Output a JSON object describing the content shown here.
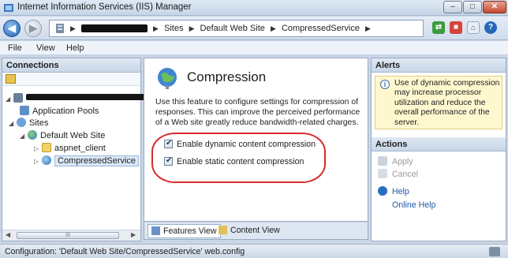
{
  "window": {
    "title": "Internet Information Services (IIS) Manager",
    "controls": {
      "minimize": "–",
      "maximize": "□",
      "close": "✕"
    }
  },
  "address_bar": {
    "breadcrumbs": [
      "Sites",
      "Default Web Site",
      "CompressedService"
    ],
    "separator": "▶"
  },
  "menu": {
    "file": "File",
    "view": "View",
    "help": "Help"
  },
  "connections": {
    "header": "Connections",
    "tree": {
      "app_pools": "Application Pools",
      "sites": "Sites",
      "default_web_site": "Default Web Site",
      "aspnet_client": "aspnet_client",
      "compressed_service": "CompressedService"
    },
    "scrollbar_grip": "III"
  },
  "feature": {
    "title": "Compression",
    "description": "Use this feature to configure settings for compression of responses. This can improve the perceived performance of a Web site greatly reduce bandwidth-related charges.",
    "checkboxes": [
      {
        "label": "Enable dynamic content compression",
        "checked": true
      },
      {
        "label": "Enable static content compression",
        "checked": true
      }
    ]
  },
  "view_tabs": {
    "features_view": "Features View",
    "content_view": "Content View"
  },
  "alerts": {
    "header": "Alerts",
    "message": "Use of dynamic compression may increase processor utilization and reduce the overall performance of the server."
  },
  "actions": {
    "header": "Actions",
    "apply": "Apply",
    "cancel": "Cancel",
    "help": "Help",
    "online_help": "Online Help"
  },
  "status_bar": {
    "text": "Configuration: 'Default Web Site/CompressedService' web.config"
  },
  "colors": {
    "annotation_ring": "#d62b2b",
    "link": "#1f5aa8",
    "alert_background": "#fff8cf"
  }
}
